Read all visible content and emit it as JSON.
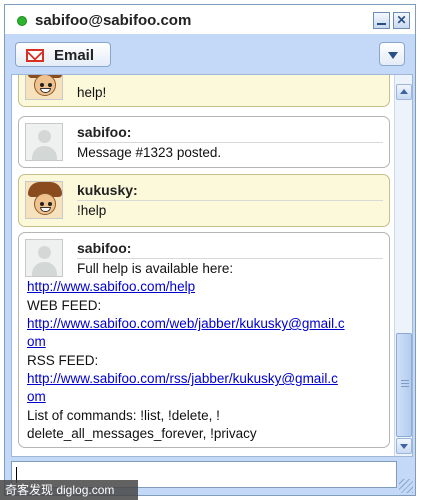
{
  "window": {
    "title": "sabifoo@sabifoo.com",
    "status_color": "#2cb52c",
    "minimize_label": "",
    "close_label": "✕"
  },
  "toolbar": {
    "email_label": "Email",
    "menu_icon": "chevron-down-icon"
  },
  "messages": [
    {
      "sender": "",
      "avatar": "pirate",
      "own": true,
      "lines": [
        "help!"
      ]
    },
    {
      "sender": "sabifoo:",
      "avatar": "generic",
      "own": false,
      "lines": [
        "Message #1323 posted."
      ]
    },
    {
      "sender": "kukusky:",
      "avatar": "pirate",
      "own": true,
      "lines": [
        "!help"
      ]
    },
    {
      "sender": "sabifoo:",
      "avatar": "generic",
      "own": false,
      "intro": "Full help is available here:",
      "help_link": "http://www.sabifoo.com/help",
      "web_feed_label": "WEB FEED:",
      "web_feed_link_1": "http://www.sabifoo.com/web/jabber/kukusky@gmail.c",
      "web_feed_link_2": "om",
      "rss_feed_label": "RSS FEED:",
      "rss_feed_link_1": "http://www.sabifoo.com/rss/jabber/kukusky@gmail.c",
      "rss_feed_link_2": "om",
      "commands_1": "List of commands: !list, !delete, !",
      "commands_2": "delete_all_messages_forever, !privacy"
    }
  ],
  "input": {
    "value": ""
  },
  "watermark": "奇客发现 diglog.com",
  "colors": {
    "own_bubble": "#fbf9d9",
    "other_bubble": "#ffffff",
    "link": "#0000cc",
    "frame": "#c3d9f7"
  }
}
